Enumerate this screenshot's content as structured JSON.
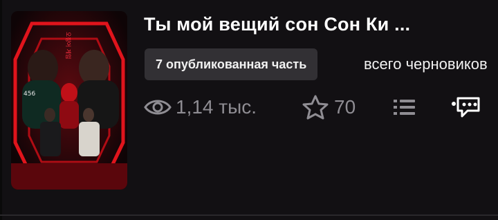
{
  "story": {
    "title": "Ты мой вещий сон Сон Ки ...",
    "published_badge": "7 опубликованная часть",
    "drafts_text": "всего черновиков",
    "cover_caption": "오징어 게임",
    "cover_number": "456"
  },
  "stats": {
    "views": "1,14 тыс.",
    "stars": "70"
  },
  "icons": {
    "views": "eye-icon",
    "stars": "star-icon",
    "toc": "list-icon",
    "comments": "comment-icon"
  },
  "colors": {
    "background": "#121013",
    "badge_bg": "#323034",
    "stat_gray": "#8f8d93",
    "cover_red": "#d0121a"
  }
}
